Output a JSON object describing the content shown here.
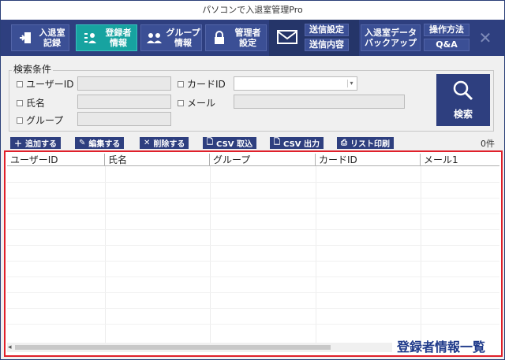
{
  "window": {
    "title": "パソコンで入退室管理Pro"
  },
  "nav": {
    "entry_log": "入退室\n記録",
    "registrant_info": "登録者\n情報",
    "group_info": "グループ\n情報",
    "admin_settings": "管理者\n設定",
    "send_settings": "送信設定",
    "send_content": "送信内容",
    "backup": "入退室データ\nバックアップ",
    "how_to": "操作方法",
    "qa": "Q&A",
    "close": "✕"
  },
  "search": {
    "legend": "検索条件",
    "user_id_label": "ユーザーID",
    "name_label": "氏名",
    "group_label": "グループ",
    "card_id_label": "カードID",
    "mail_label": "メール",
    "search_button": "検索"
  },
  "toolbar": {
    "add": "追加する",
    "edit": "編集する",
    "delete": "削除する",
    "csv_import": "CSV 取込",
    "csv_export": "CSV 出力",
    "print": "リスト印刷",
    "count": "0件"
  },
  "table": {
    "columns": [
      "ユーザーID",
      "氏名",
      "グループ",
      "カードID",
      "メール1"
    ]
  },
  "overlay_label": "登録者情報一覧",
  "colors": {
    "nav_bg": "#2e3f7f",
    "active_tab": "#17a3a0",
    "highlight_border": "#e0202a"
  }
}
